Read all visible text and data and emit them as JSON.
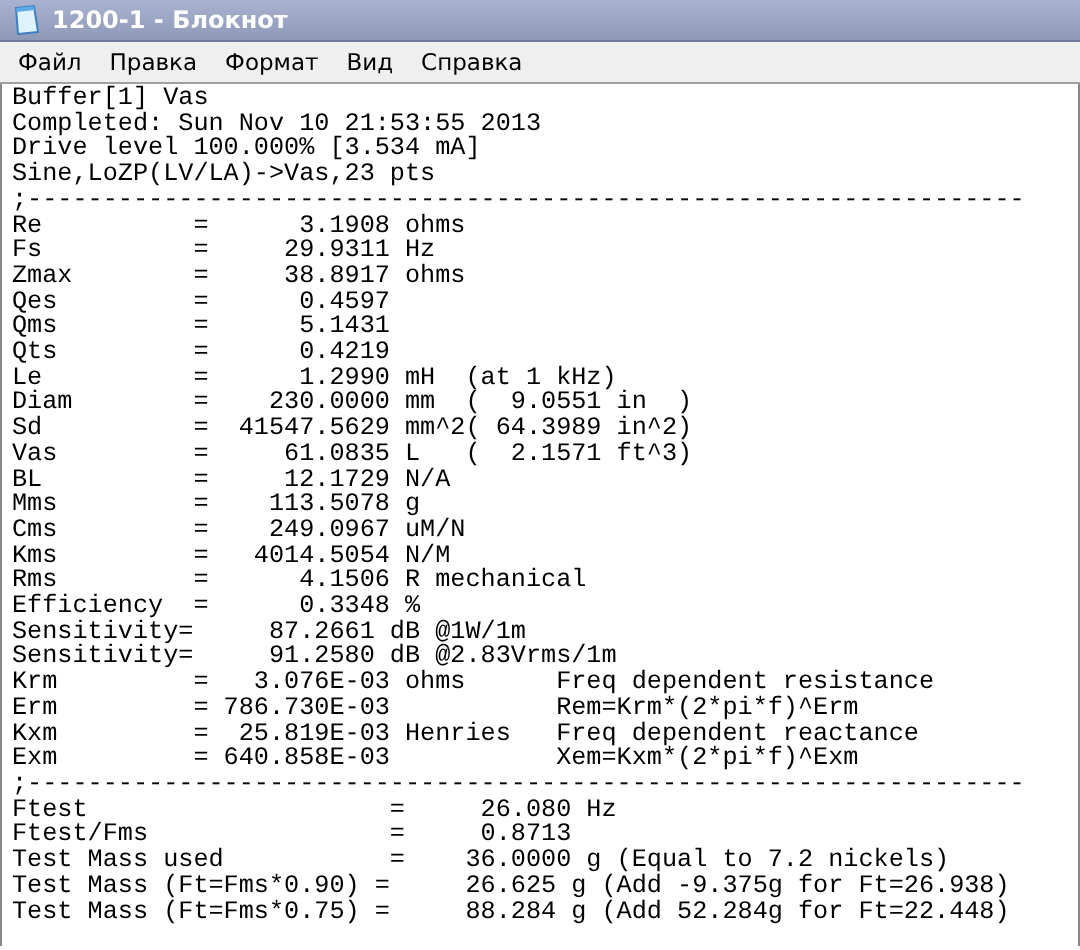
{
  "window": {
    "title": "1200-1 - Блокнот"
  },
  "menu": [
    "Файл",
    "Правка",
    "Формат",
    "Вид",
    "Справка"
  ],
  "lines": [
    "Buffer[1] Vas",
    "Completed: Sun Nov 10 21:53:55 2013",
    "Drive level 100.000% [3.534 mA]",
    "Sine,LoZP(LV/LA)->Vas,23 pts",
    ";------------------------------------------------------------------",
    "Re          =      3.1908 ohms",
    "Fs          =     29.9311 Hz",
    "Zmax        =     38.8917 ohms",
    "Qes         =      0.4597",
    "Qms         =      5.1431",
    "Qts         =      0.4219",
    "Le          =      1.2990 mH  (at 1 kHz)",
    "Diam        =    230.0000 mm  (  9.0551 in  )",
    "Sd          =  41547.5629 mm^2( 64.3989 in^2)",
    "Vas         =     61.0835 L   (  2.1571 ft^3)",
    "BL          =     12.1729 N/A",
    "Mms         =    113.5078 g",
    "Cms         =    249.0967 uM/N",
    "Kms         =   4014.5054 N/M",
    "Rms         =      4.1506 R mechanical",
    "Efficiency  =      0.3348 %",
    "Sensitivity=     87.2661 dB @1W/1m",
    "Sensitivity=     91.2580 dB @2.83Vrms/1m",
    "Krm         =   3.076E-03 ohms      Freq dependent resistance",
    "Erm         = 786.730E-03           Rem=Krm*(2*pi*f)^Erm",
    "Kxm         =  25.819E-03 Henries   Freq dependent reactance",
    "Exm         = 640.858E-03           Xem=Kxm*(2*pi*f)^Exm",
    ";------------------------------------------------------------------",
    "Ftest                    =     26.080 Hz",
    "Ftest/Fms                =     0.8713",
    "Test Mass used           =    36.0000 g (Equal to 7.2 nickels)",
    "Test Mass (Ft=Fms*0.90) =     26.625 g (Add -9.375g for Ft=26.938)",
    "Test Mass (Ft=Fms*0.75) =     88.284 g (Add 52.284g for Ft=22.448)"
  ]
}
